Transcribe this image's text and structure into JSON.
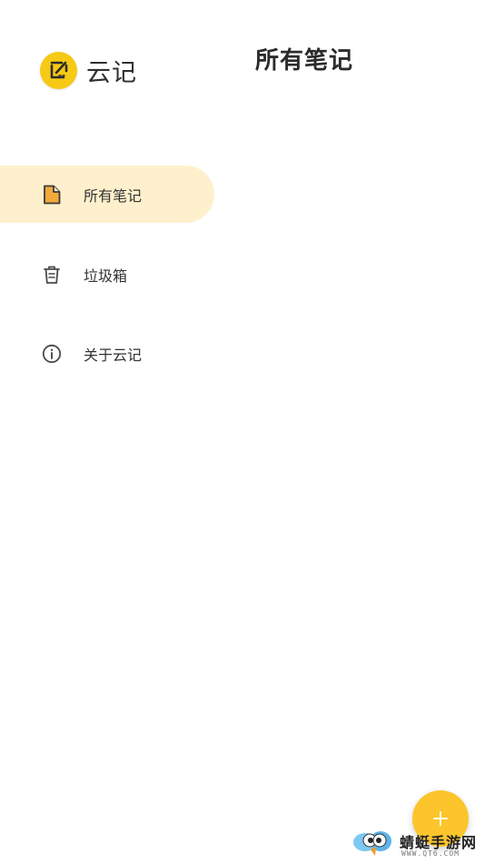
{
  "app": {
    "name": "云记",
    "logo_icon": "edit-note-icon",
    "accent_color": "#F6C915"
  },
  "header": {
    "title": "所有笔记"
  },
  "sidebar": {
    "items": [
      {
        "label": "所有笔记",
        "icon": "note-icon",
        "active": true
      },
      {
        "label": "垃圾箱",
        "icon": "trash-icon",
        "active": false
      },
      {
        "label": "关于云记",
        "icon": "info-icon",
        "active": false
      }
    ],
    "active_color": "#FFF0CD"
  },
  "fab": {
    "icon": "plus-icon",
    "color": "#FBC52B"
  },
  "watermark": {
    "title": "蜻蜓手游网",
    "url": "WWW.QT6.COM"
  }
}
